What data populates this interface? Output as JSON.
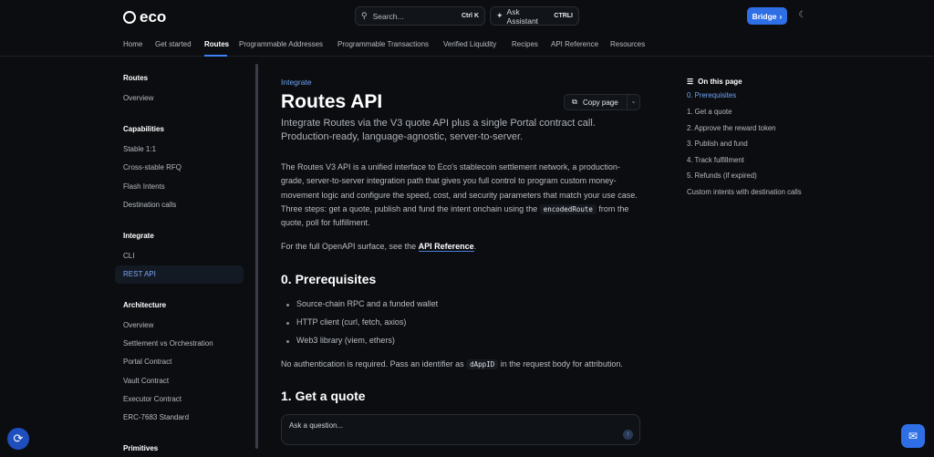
{
  "header": {
    "logo_text": "eco",
    "search_placeholder": "Search...",
    "search_shortcut": "Ctrl K",
    "assistant_label": "Ask Assistant",
    "assistant_shortcut": "CTRLI",
    "bridge_label": "Bridge",
    "icons": {
      "search": "search-icon",
      "assistant": "sparkle-icon",
      "bridge": "chevron-right-icon",
      "theme": "moon-icon"
    }
  },
  "nav": {
    "tabs": [
      "Home",
      "Get started",
      "Routes",
      "Programmable Addresses",
      "Programmable Transactions",
      "Verified Liquidity",
      "Recipes",
      "API Reference",
      "Resources"
    ],
    "active_tab": "Routes"
  },
  "sidebar": {
    "routes_heading": "Routes",
    "routes_items": [
      "Overview"
    ],
    "capabilities_heading": "Capabilities",
    "capabilities_items": [
      "Stable 1:1",
      "Cross-stable RFQ",
      "Flash Intents",
      "Destination calls"
    ],
    "integrate_heading": "Integrate",
    "integrate_items": [
      "CLI",
      "REST API"
    ],
    "active_item": "REST API",
    "architecture_heading": "Architecture",
    "architecture_items": [
      "Overview",
      "Settlement vs Orchestration",
      "Portal Contract",
      "Vault Contract",
      "Executor Contract",
      "ERC-7683 Standard"
    ],
    "primitives_heading": "Primitives"
  },
  "main": {
    "kicker": "Integrate",
    "title": "Routes API",
    "copy_page_label": "Copy page",
    "lead": "Integrate Routes via the V3 quote API plus a single Portal contract call. Production-ready, language-agnostic, server-to-server.",
    "intro_before_code": "The Routes V3 API is a unified interface to Eco's stablecoin settlement network, a production-grade, server-to-server integration path that gives you full control to program custom money-movement logic and configure the speed, cost, and security parameters that match your use case. Three steps: get a quote, publish and fund the intent onchain using the",
    "intro_code": "encodedRoute",
    "intro_after_code": "from the quote, poll for fulfillment.",
    "openapi_before": "For the full OpenAPI surface, see the",
    "openapi_link": "API Reference",
    "openapi_after": ".",
    "section0_title": "0. Prerequisites",
    "prereqs": [
      "Source-chain RPC and a funded wallet",
      "HTTP client (curl, fetch, axios)",
      "Web3 library (viem, ethers)"
    ],
    "auth_before": "No authentication is required. Pass an identifier as",
    "auth_code": "dAppID",
    "auth_after": "in the request body for attribution.",
    "section1_title": "1. Get a quote"
  },
  "ask": {
    "placeholder": "Ask a question..."
  },
  "toc": {
    "heading": "On this page",
    "items": [
      "0. Prerequisites",
      "1. Get a quote",
      "2. Approve the reward token",
      "3. Publish and fund",
      "4. Track fulfillment",
      "5. Refunds (if expired)",
      "Custom intents with destination calls"
    ],
    "active_item": "0. Prerequisites"
  },
  "colors": {
    "accent": "#2f6fe6",
    "link": "#6ea3f4",
    "background": "#0b0d10"
  }
}
